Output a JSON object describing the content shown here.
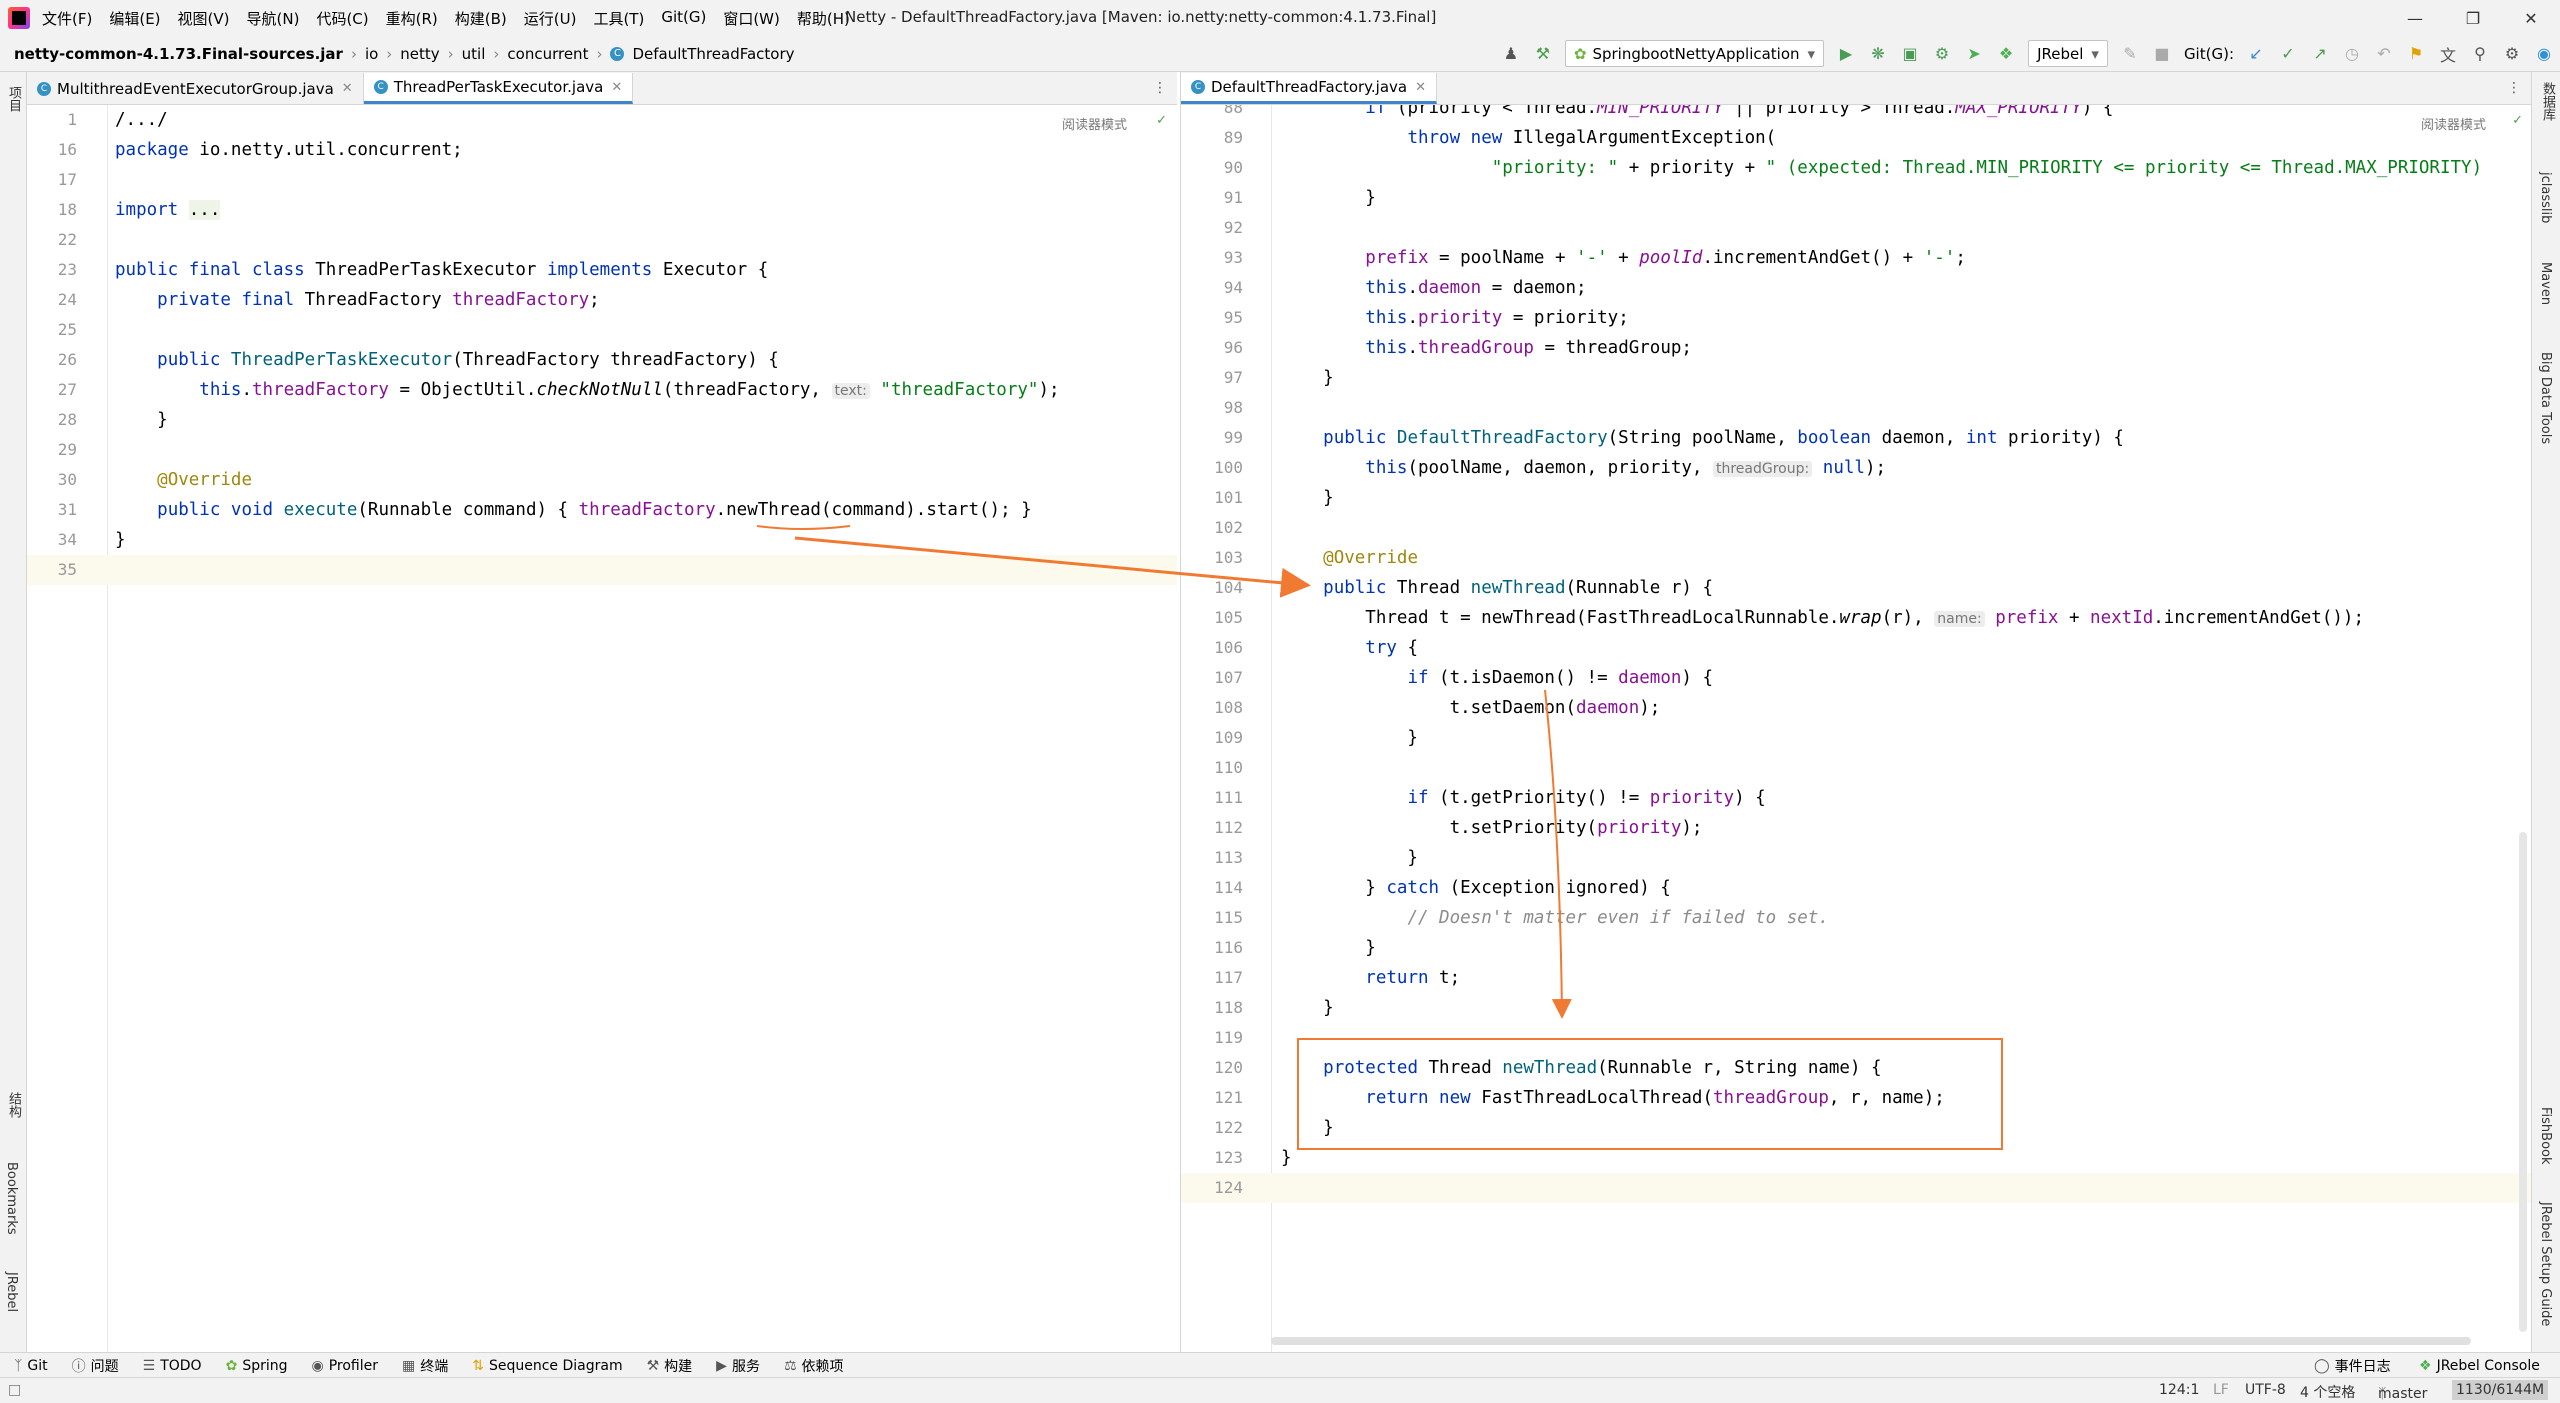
{
  "menu": [
    "文件(F)",
    "编辑(E)",
    "视图(V)",
    "导航(N)",
    "代码(C)",
    "重构(R)",
    "构建(B)",
    "运行(U)",
    "工具(T)",
    "Git(G)",
    "窗口(W)",
    "帮助(H)"
  ],
  "window_title": "Netty - DefaultThreadFactory.java [Maven: io.netty:netty-common:4.1.73.Final]",
  "breadcrumbs": [
    "netty-common-4.1.73.Final-sources.jar",
    "io",
    "netty",
    "util",
    "concurrent",
    "DefaultThreadFactory"
  ],
  "run_config": "SpringbootNettyApplication",
  "jrebel_label": "JRebel",
  "git_label": "Git(G):",
  "left_tabs": [
    "MultithreadEventExecutorGroup.java",
    "ThreadPerTaskExecutor.java"
  ],
  "right_tabs": [
    "DefaultThreadFactory.java"
  ],
  "reader_mode": "阅读器模式",
  "left_strip": [
    "项目",
    "结构",
    "Bookmarks",
    "JRebel"
  ],
  "right_strip": [
    "数据库",
    "jclasslib",
    "Maven",
    "Big Data Tools",
    "FishBook",
    "JRebel Setup Guide"
  ],
  "left_code": [
    {
      "n": "1",
      "h": "/.../"
    },
    {
      "n": "16",
      "h": "<span class='kw'>package</span> io.netty.util.concurrent;"
    },
    {
      "n": "17",
      "h": ""
    },
    {
      "n": "18",
      "h": "<span class='kw'>import</span> <span style='background:#eef5e8'>...</span>"
    },
    {
      "n": "22",
      "h": ""
    },
    {
      "n": "23",
      "h": "<span class='kw'>public final class</span> ThreadPerTaskExecutor <span class='kw'>implements</span> Executor {"
    },
    {
      "n": "24",
      "h": "    <span class='kw'>private final</span> ThreadFactory <span class='fld'>threadFactory</span>;"
    },
    {
      "n": "25",
      "h": ""
    },
    {
      "n": "26",
      "h": "    <span class='kw'>public</span> <span class='mth'>ThreadPerTaskExecutor</span>(ThreadFactory threadFactory) {"
    },
    {
      "n": "27",
      "h": "        <span class='kw'>this</span>.<span class='fld'>threadFactory</span> = ObjectUtil.<span class='ital'>checkNotNull</span>(threadFactory, <span class='hint'>text:</span> <span class='str'>\"threadFactory\"</span>);"
    },
    {
      "n": "28",
      "h": "    }"
    },
    {
      "n": "29",
      "h": ""
    },
    {
      "n": "30",
      "h": "    <span class='ann'>@Override</span>"
    },
    {
      "n": "31",
      "h": "    <span class='kw'>public void</span> <span class='mth'>execute</span>(Runnable command) { <span class='fld'>threadFactory</span>.newThread(command).start(); }"
    },
    {
      "n": "34",
      "h": "}"
    },
    {
      "n": "35",
      "h": ""
    }
  ],
  "right_code": [
    {
      "n": "88",
      "h": "        <span class='kw'>if</span> (priority &lt; Thread.<span class='fld ital'>MIN_PRIORITY</span> || priority &gt; Thread.<span class='fld ital'>MAX_PRIORITY</span>) {"
    },
    {
      "n": "89",
      "h": "            <span class='kw'>throw new</span> IllegalArgumentException("
    },
    {
      "n": "90",
      "h": "                    <span class='str'>\"priority: \"</span> + priority + <span class='str'>\" (expected: Thread.MIN_PRIORITY &lt;= priority &lt;= Thread.MAX_PRIORITY)</span>"
    },
    {
      "n": "91",
      "h": "        }"
    },
    {
      "n": "92",
      "h": ""
    },
    {
      "n": "93",
      "h": "        <span class='fld'>prefix</span> = poolName + <span class='str'>'-'</span> + <span class='fld ital'>poolId</span>.incrementAndGet() + <span class='str'>'-'</span>;"
    },
    {
      "n": "94",
      "h": "        <span class='kw'>this</span>.<span class='fld'>daemon</span> = daemon;"
    },
    {
      "n": "95",
      "h": "        <span class='kw'>this</span>.<span class='fld'>priority</span> = priority;"
    },
    {
      "n": "96",
      "h": "        <span class='kw'>this</span>.<span class='fld'>threadGroup</span> = threadGroup;"
    },
    {
      "n": "97",
      "h": "    }"
    },
    {
      "n": "98",
      "h": ""
    },
    {
      "n": "99",
      "h": "    <span class='kw'>public</span> <span class='mth'>DefaultThreadFactory</span>(String poolName, <span class='kw'>boolean</span> daemon, <span class='kw'>int</span> priority) {"
    },
    {
      "n": "100",
      "h": "        <span class='kw'>this</span>(poolName, daemon, priority, <span class='hint'>threadGroup:</span> <span class='kw'>null</span>);"
    },
    {
      "n": "101",
      "h": "    }"
    },
    {
      "n": "102",
      "h": ""
    },
    {
      "n": "103",
      "h": "    <span class='ann'>@Override</span>"
    },
    {
      "n": "104",
      "h": "    <span class='kw'>public</span> Thread <span class='mth'>newThread</span>(Runnable r) {"
    },
    {
      "n": "105",
      "h": "        Thread t = newThread(FastThreadLocalRunnable.<span class='ital'>wrap</span>(r), <span class='hint'>name:</span> <span class='fld'>prefix</span> + <span class='fld'>nextId</span>.incrementAndGet());"
    },
    {
      "n": "106",
      "h": "        <span class='kw'>try</span> {"
    },
    {
      "n": "107",
      "h": "            <span class='kw'>if</span> (t.isDaemon() != <span class='fld'>daemon</span>) {"
    },
    {
      "n": "108",
      "h": "                t.setDaemon(<span class='fld'>daemon</span>);"
    },
    {
      "n": "109",
      "h": "            }"
    },
    {
      "n": "110",
      "h": ""
    },
    {
      "n": "111",
      "h": "            <span class='kw'>if</span> (t.getPriority() != <span class='fld'>priority</span>) {"
    },
    {
      "n": "112",
      "h": "                t.setPriority(<span class='fld'>priority</span>);"
    },
    {
      "n": "113",
      "h": "            }"
    },
    {
      "n": "114",
      "h": "        } <span class='kw'>catch</span> (Exception ignored) {"
    },
    {
      "n": "115",
      "h": "            <span class='cmt'>// Doesn't matter even if failed to set.</span>"
    },
    {
      "n": "116",
      "h": "        }"
    },
    {
      "n": "117",
      "h": "        <span class='kw'>return</span> t;"
    },
    {
      "n": "118",
      "h": "    }"
    },
    {
      "n": "119",
      "h": ""
    },
    {
      "n": "120",
      "h": "    <span class='kw'>protected</span> Thread <span class='mth'>newThread</span>(Runnable r, String name) {"
    },
    {
      "n": "121",
      "h": "        <span class='kw'>return new</span> FastThreadLocalThread(<span class='fld'>threadGroup</span>, r, name);"
    },
    {
      "n": "122",
      "h": "    }"
    },
    {
      "n": "123",
      "h": "}"
    },
    {
      "n": "124",
      "h": ""
    }
  ],
  "bottom_tools": [
    "Git",
    "问题",
    "TODO",
    "Spring",
    "Profiler",
    "终端",
    "Sequence Diagram",
    "构建",
    "服务",
    "依赖项"
  ],
  "bottom_right": [
    "事件日志",
    "JRebel Console"
  ],
  "status": {
    "pos": "124:1",
    "sep": "LF",
    "enc": "UTF-8",
    "indent": "4 个空格",
    "branch": "master",
    "mem": "1130/6144M"
  }
}
